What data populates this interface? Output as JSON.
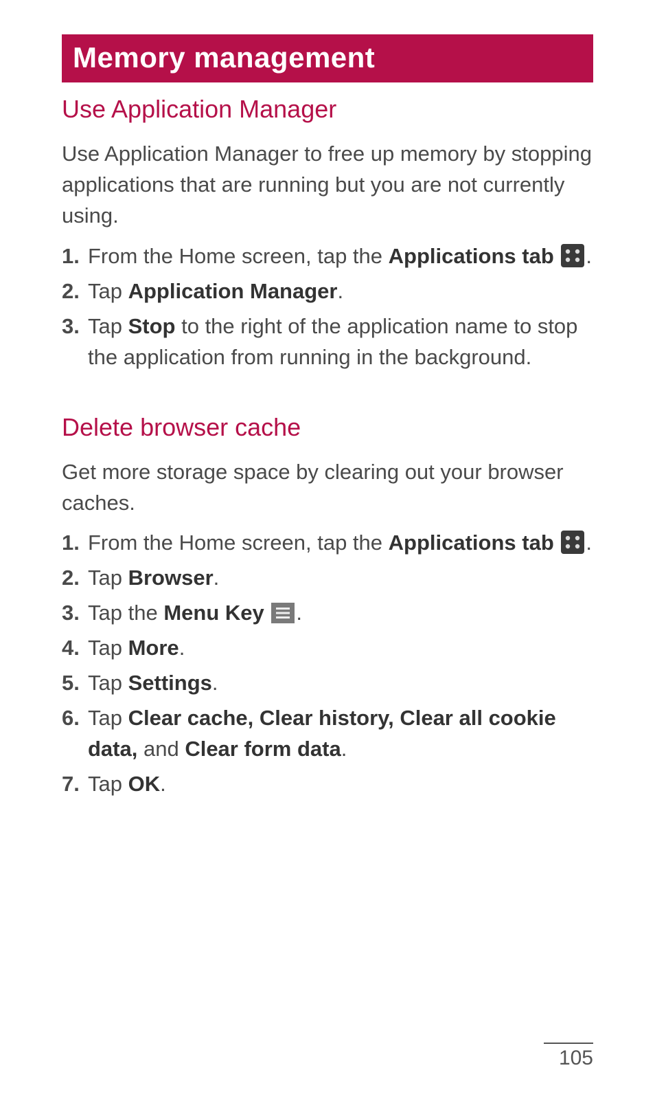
{
  "title": "Memory management",
  "page_number": "105",
  "section1": {
    "heading": "Use Application Manager",
    "intro": "Use Application Manager to free up memory by stopping applications that are running but you are not currently using.",
    "steps": [
      {
        "num": "1.",
        "pre": "From the Home screen, tap the ",
        "bold": "Applications tab",
        "icon": "apps",
        "post": "."
      },
      {
        "num": "2.",
        "pre": "Tap ",
        "bold": "Application Manager",
        "post": "."
      },
      {
        "num": "3.",
        "pre": "Tap ",
        "bold": "Stop",
        "post": " to the right of the application name to stop the application from running in the background."
      }
    ]
  },
  "section2": {
    "heading": "Delete browser cache",
    "intro": "Get more storage space by clearing out your browser caches.",
    "steps": [
      {
        "num": "1.",
        "pre": "From the Home screen, tap the ",
        "bold": "Applications tab",
        "icon": "apps",
        "post": "."
      },
      {
        "num": "2.",
        "pre": "Tap ",
        "bold": "Browser",
        "post": "."
      },
      {
        "num": "3.",
        "pre": "Tap the ",
        "bold": "Menu Key",
        "icon": "menu",
        "post": "."
      },
      {
        "num": "4.",
        "pre": "Tap ",
        "bold": "More",
        "post": "."
      },
      {
        "num": "5.",
        "pre": "Tap ",
        "bold": "Settings",
        "post": "."
      },
      {
        "num": "6.",
        "pre": "Tap ",
        "bold": "Clear cache, Clear history, Clear all cookie data,",
        "mid": " and ",
        "bold2": "Clear form data",
        "post": "."
      },
      {
        "num": "7.",
        "pre": "Tap ",
        "bold": "OK",
        "post": "."
      }
    ]
  }
}
